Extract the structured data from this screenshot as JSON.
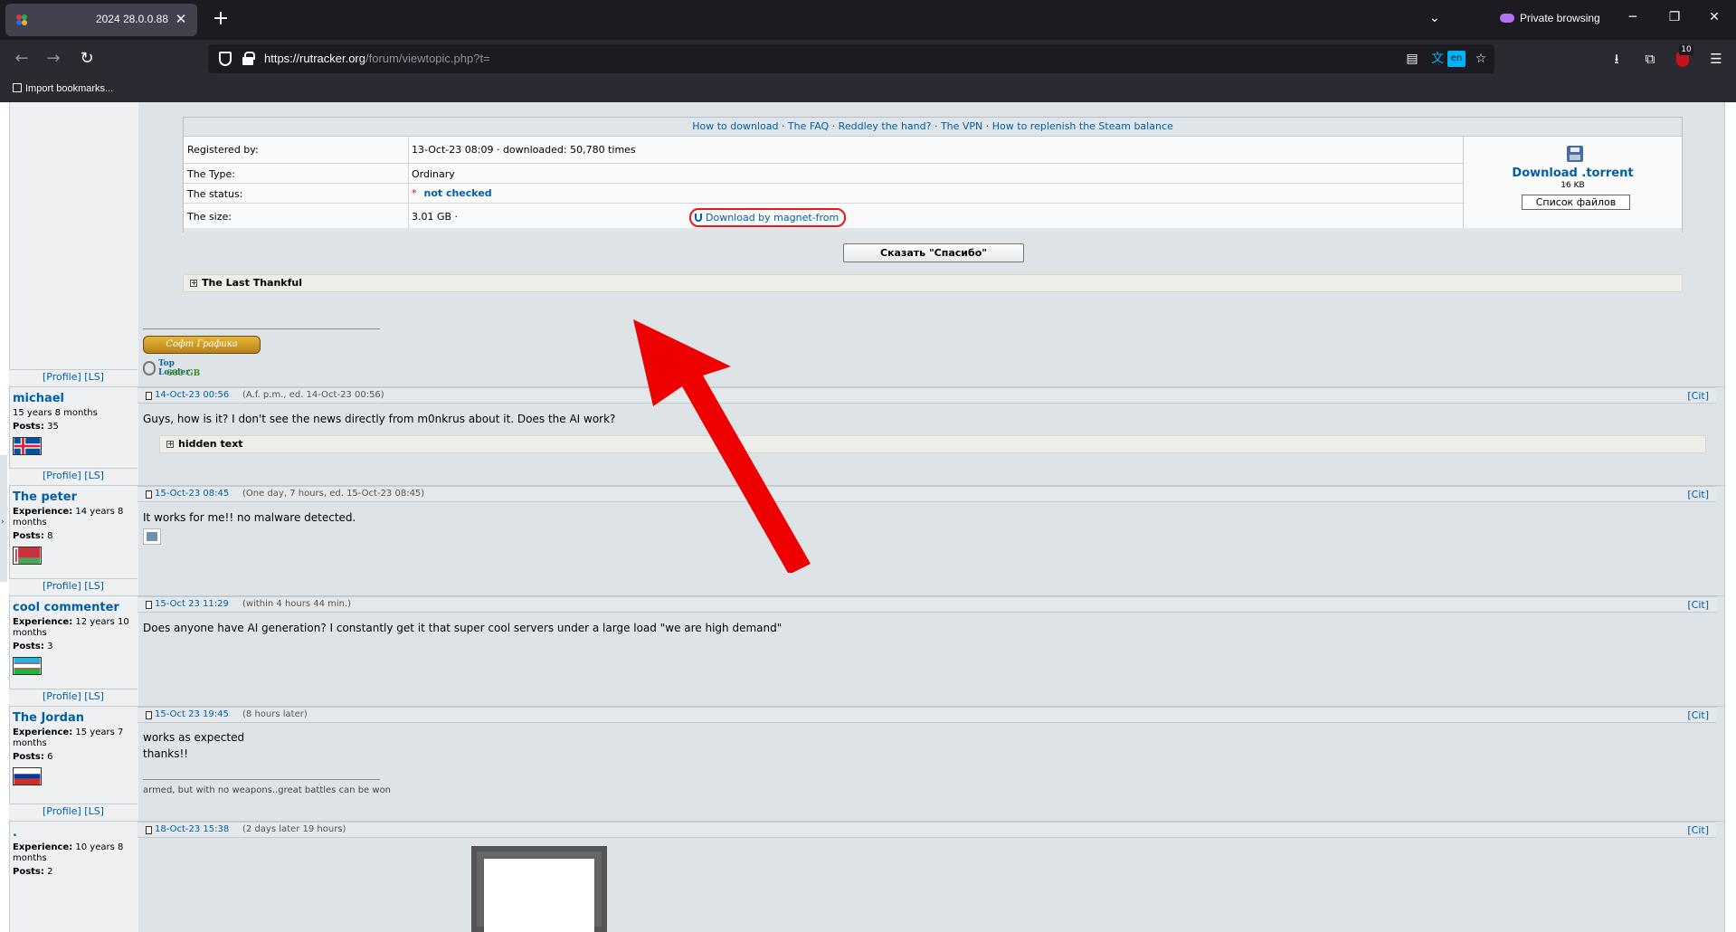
{
  "browser": {
    "tab_title": "2024 28.0.0.88",
    "private_label": "Private browsing",
    "url_host": "https://rutracker.org",
    "url_path": "/forum/viewtopic.php?t=",
    "translate_lang": "en",
    "ext_badge_count": "10",
    "bookmark_import": "Import bookmarks..."
  },
  "torrent": {
    "links": "How to download · The FAQ · Reddley the hand? · The VPN · How to replenish the Steam balance",
    "rows": [
      {
        "label": "Registered by:",
        "value": "13-Oct-23 08:09 · downloaded: 50,780 times"
      },
      {
        "label": "The Type:",
        "value": "Ordinary"
      },
      {
        "label": "The status:",
        "star": "*",
        "value": "not checked"
      },
      {
        "label": "The size:",
        "value": "3.01 GB ·",
        "magnet": "Download by magnet-from"
      }
    ],
    "download_title": "Download .torrent",
    "download_size": "16 KB",
    "files_button": "Список файлов"
  },
  "thanks_button": "Сказать \"Спасибо\"",
  "last_thankful": "The Last Thankful",
  "signature_badge": "Софт Графика",
  "top_loader": {
    "title": "Top Loader",
    "amount": "600 GB"
  },
  "profile_links": "[Profile] [LS]",
  "cit_label": "[Cit]",
  "posts": [
    {
      "author": "michael",
      "exp_label": "",
      "exp_value": "15 years 8 months",
      "posts_label": "Posts:",
      "posts_value": "35",
      "date": "14-Oct-23 00:56",
      "meta": "(A.f. p.m., ed. 14-Oct-23 00:56)",
      "body": "Guys, how is it? I don't see the news directly from m0nkrus about it. Does the AI work?",
      "spoiler": "hidden text"
    },
    {
      "author": "The peter",
      "exp_label": "Experience:",
      "exp_value": "14 years 8 months",
      "posts_label": "Posts:",
      "posts_value": "8",
      "date": "15-Oct-23 08:45",
      "meta": "(One day, 7 hours, ed. 15-Oct-23 08:45)",
      "body": "It works for me!! no malware detected."
    },
    {
      "author": "cool commenter",
      "exp_label": "Experience:",
      "exp_value": "12 years 10 months",
      "posts_label": "Posts:",
      "posts_value": "3",
      "date": "15-Oct 23 11:29",
      "meta": "(within 4 hours 44 min.)",
      "body": "Does anyone have AI generation? I constantly get it that super cool servers under a large load \"we are high demand\""
    },
    {
      "author": "The Jordan",
      "exp_label": "Experience:",
      "exp_value": "15 years 7 months",
      "posts_label": "Posts:",
      "posts_value": "6",
      "date": "15-Oct 23 19:45",
      "meta": "(8 hours later)",
      "body_line1": "works as expected",
      "body_line2": "thanks!!",
      "signature": "armed, but with no weapons..great battles can be won"
    },
    {
      "author": ".",
      "exp_label": "Experience:",
      "exp_value": "10 years 8 months",
      "posts_label": "Posts:",
      "posts_value": "2",
      "date": "18-Oct-23 15:38",
      "meta": "(2 days later 19 hours)"
    }
  ],
  "colors": {
    "link": "#005fa9",
    "annotation_red": "#e21a1a"
  }
}
